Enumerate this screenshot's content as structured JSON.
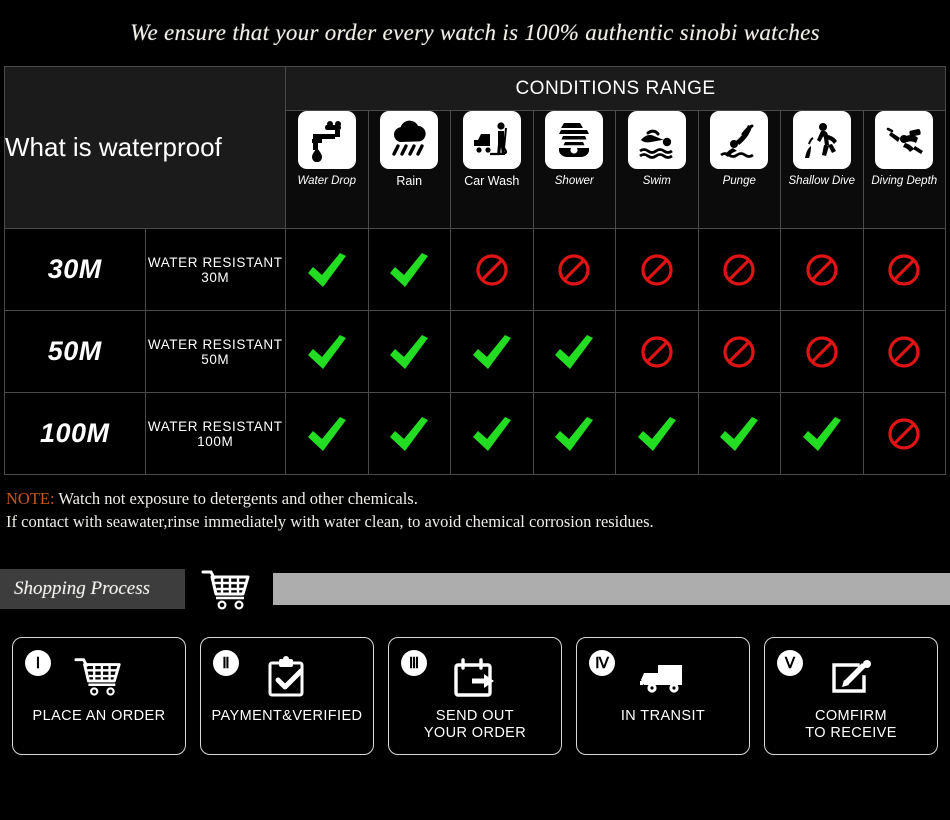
{
  "headline": "We ensure that your order every watch is 100% authentic sinobi watches",
  "table": {
    "title": "What is waterproof",
    "range_header": "CONDITIONS RANGE",
    "conditions": [
      {
        "label": "Water Drop",
        "icon": "faucet-drop-icon",
        "italic": true
      },
      {
        "label": "Rain",
        "icon": "rain-cloud-icon",
        "italic": false
      },
      {
        "label": "Car Wash",
        "icon": "car-wash-icon",
        "italic": false
      },
      {
        "label": "Shower",
        "icon": "shower-icon",
        "italic": true
      },
      {
        "label": "Swim",
        "icon": "swimmer-icon",
        "italic": true
      },
      {
        "label": "Punge",
        "icon": "plunge-dive-icon",
        "italic": true
      },
      {
        "label": "Shallow Dive",
        "icon": "shallow-dive-icon",
        "italic": true
      },
      {
        "label": "Diving Depth",
        "icon": "scuba-diver-icon",
        "italic": true
      }
    ],
    "rows": [
      {
        "depth": "30M",
        "resistance": "WATER RESISTANT  30M",
        "marks": [
          "check",
          "check",
          "deny",
          "deny",
          "deny",
          "deny",
          "deny",
          "deny"
        ]
      },
      {
        "depth": "50M",
        "resistance": "WATER RESISTANT 50M",
        "marks": [
          "check",
          "check",
          "check",
          "check",
          "deny",
          "deny",
          "deny",
          "deny"
        ]
      },
      {
        "depth": "100M",
        "resistance": "WATER RESISTANT  100M",
        "marks": [
          "check",
          "check",
          "check",
          "check",
          "check",
          "check",
          "check",
          "deny"
        ]
      }
    ]
  },
  "note": {
    "keyword": "NOTE:",
    "line1": " Watch not exposure to detergents and other chemicals.",
    "line2": "If contact with seawater,rinse immediately with water clean, to avoid chemical corrosion residues."
  },
  "shopping_process": {
    "label": "Shopping Process",
    "cart_icon": "shopping-cart-icon",
    "steps": [
      {
        "numeral": "Ⅰ",
        "label": "PLACE AN ORDER",
        "icon": "cart-icon"
      },
      {
        "numeral": "Ⅱ",
        "label": "PAYMENT&VERIFIED",
        "icon": "clipboard-check-icon"
      },
      {
        "numeral": "Ⅲ",
        "label": "SEND OUT\nYOUR ORDER",
        "icon": "calendar-arrow-icon"
      },
      {
        "numeral": "Ⅳ",
        "label": "IN TRANSIT",
        "icon": "delivery-truck-icon"
      },
      {
        "numeral": "Ⅴ",
        "label": "COMFIRM\nTO RECEIVE",
        "icon": "note-pencil-icon"
      }
    ]
  },
  "colors": {
    "background": "#000000",
    "check_green": "#22dd22",
    "deny_red": "#e01414",
    "note_keyword": "#c4571f",
    "header_bg": "#1b1b1b",
    "gray_bar": "#adadad",
    "process_label_bg": "#3d3d3d"
  }
}
